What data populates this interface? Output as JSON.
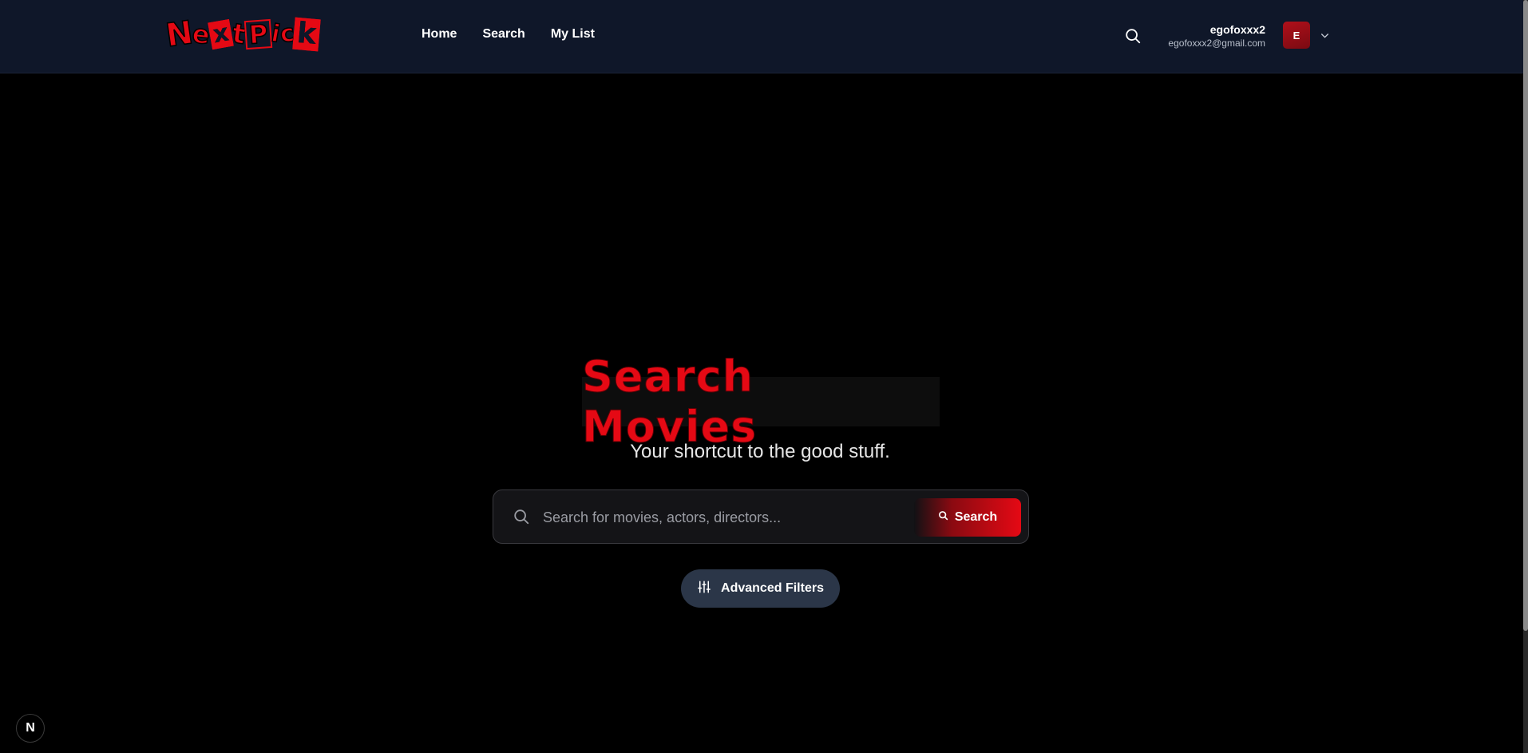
{
  "header": {
    "logo_text": "NextPick",
    "nav": [
      {
        "label": "Home"
      },
      {
        "label": "Search"
      },
      {
        "label": "My List"
      }
    ],
    "user": {
      "name": "egofoxxx2",
      "email": "egofoxxx2@gmail.com",
      "avatar_initial": "E"
    }
  },
  "hero": {
    "title": "Search Movies",
    "subtitle": "Your shortcut to the good stuff."
  },
  "search": {
    "placeholder": "Search for movies, actors, directors...",
    "value": "",
    "button_label": "Search"
  },
  "filters": {
    "button_label": "Advanced Filters"
  },
  "dev_badge": {
    "label": "N"
  },
  "colors": {
    "accent": "#e50914",
    "header_bg": "#0f1729",
    "background": "#000000",
    "filters_bg": "#2b3648"
  },
  "icons": {
    "header_search": "search-icon",
    "user_menu": "chevron-down-icon",
    "search_bar": "search-icon",
    "filters": "sliders-icon"
  }
}
